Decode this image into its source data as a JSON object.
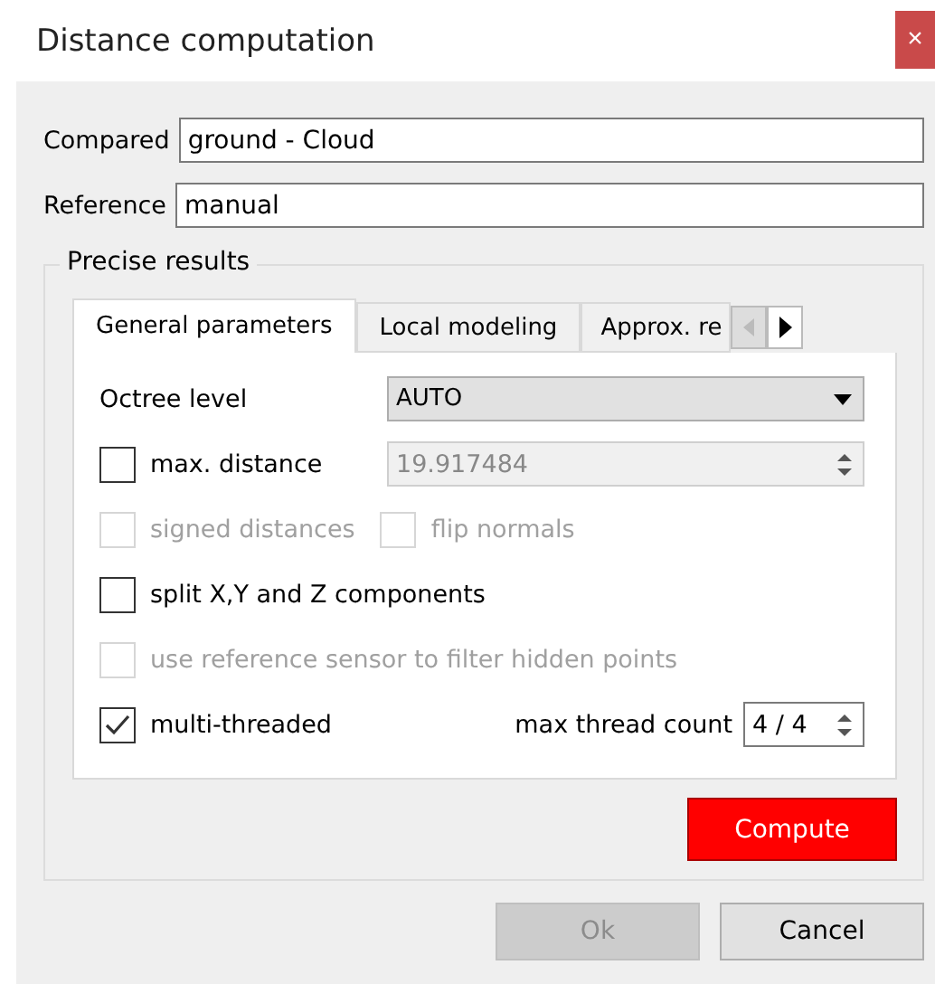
{
  "window": {
    "title": "Distance computation",
    "close": "×"
  },
  "fields": [
    {
      "label": "Compared",
      "value": "ground - Cloud"
    },
    {
      "label": "Reference",
      "value": "manual"
    }
  ],
  "group": {
    "title": "Precise results",
    "tabs": [
      {
        "label": "General parameters",
        "selected": true
      },
      {
        "label": "Local modeling",
        "selected": false
      },
      {
        "label": "Approx. re",
        "selected": false
      }
    ],
    "rows": [
      {
        "kind": "combo",
        "label": "Octree level",
        "value": "AUTO"
      },
      {
        "kind": "checkspin",
        "label": "max. distance",
        "checked": false,
        "disabled": false,
        "value": "19.917484",
        "value_disabled": true
      },
      {
        "kind": "pair",
        "items": [
          {
            "label": "signed distances",
            "checked": false,
            "disabled": true
          },
          {
            "label": "flip normals",
            "checked": false,
            "disabled": true
          }
        ]
      },
      {
        "kind": "check",
        "label": "split X,Y and Z components",
        "checked": false,
        "disabled": false
      },
      {
        "kind": "check",
        "label": "use reference sensor to filter hidden points",
        "checked": false,
        "disabled": true
      },
      {
        "kind": "checkcount",
        "label": "multi-threaded",
        "checked": true,
        "disabled": false,
        "count_label": "max thread count",
        "value": "4 / 4"
      }
    ],
    "compute": "Compute"
  },
  "buttons": [
    {
      "label": "Ok",
      "disabled": true
    },
    {
      "label": "Cancel",
      "disabled": false
    }
  ]
}
